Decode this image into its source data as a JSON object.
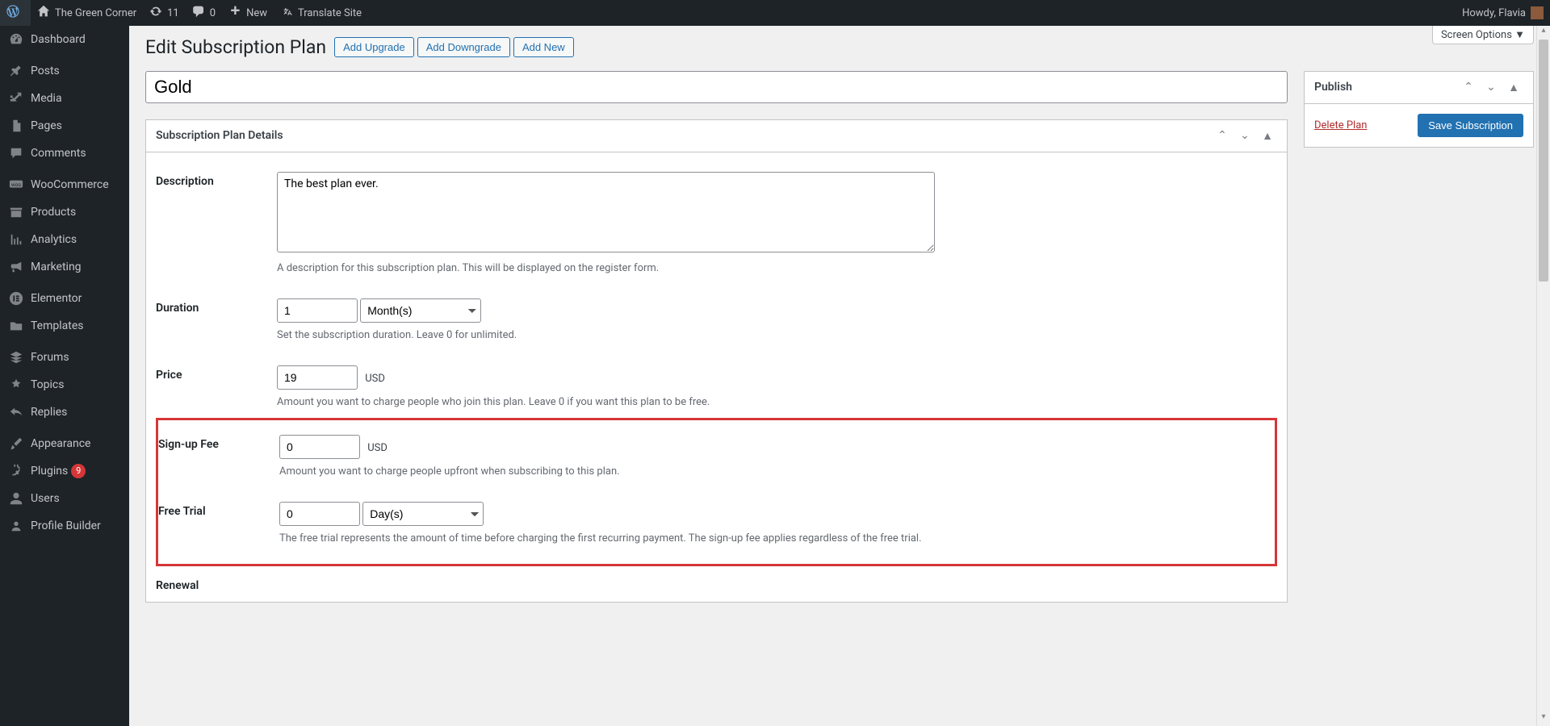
{
  "adminbar": {
    "site_name": "The Green Corner",
    "updates_count": "11",
    "comments_count": "0",
    "new_label": "New",
    "translate_label": "Translate Site",
    "howdy": "Howdy, Flavia"
  },
  "sidebar": {
    "items": [
      {
        "label": "Dashboard",
        "icon": "dashboard-icon"
      },
      {
        "sep": true
      },
      {
        "label": "Posts",
        "icon": "pin-icon"
      },
      {
        "label": "Media",
        "icon": "media-icon"
      },
      {
        "label": "Pages",
        "icon": "page-icon"
      },
      {
        "label": "Comments",
        "icon": "comment-icon"
      },
      {
        "sep": true
      },
      {
        "label": "WooCommerce",
        "icon": "woo-icon"
      },
      {
        "label": "Products",
        "icon": "archive-icon"
      },
      {
        "label": "Analytics",
        "icon": "chart-icon"
      },
      {
        "label": "Marketing",
        "icon": "megaphone-icon"
      },
      {
        "sep": true
      },
      {
        "label": "Elementor",
        "icon": "elementor-icon"
      },
      {
        "label": "Templates",
        "icon": "folder-icon"
      },
      {
        "sep": true
      },
      {
        "label": "Forums",
        "icon": "forum-icon"
      },
      {
        "label": "Topics",
        "icon": "topic-icon"
      },
      {
        "label": "Replies",
        "icon": "reply-icon"
      },
      {
        "sep": true
      },
      {
        "label": "Appearance",
        "icon": "brush-icon"
      },
      {
        "label": "Plugins",
        "icon": "plug-icon",
        "badge": "9"
      },
      {
        "label": "Users",
        "icon": "user-icon"
      },
      {
        "label": "Profile Builder",
        "icon": "profile-icon"
      }
    ]
  },
  "screen_options": "Screen Options ▼",
  "page": {
    "title": "Edit Subscription Plan",
    "buttons": {
      "add_upgrade": "Add Upgrade",
      "add_downgrade": "Add Downgrade",
      "add_new": "Add New"
    },
    "plan_title": "Gold"
  },
  "details": {
    "heading": "Subscription Plan Details",
    "description": {
      "label": "Description",
      "value": "The best plan ever.",
      "help": "A description for this subscription plan. This will be displayed on the register form."
    },
    "duration": {
      "label": "Duration",
      "value": "1",
      "unit": "Month(s)",
      "help": "Set the subscription duration. Leave 0 for unlimited."
    },
    "price": {
      "label": "Price",
      "value": "19",
      "currency": "USD",
      "help": "Amount you want to charge people who join this plan. Leave 0 if you want this plan to be free."
    },
    "signup_fee": {
      "label": "Sign-up Fee",
      "value": "0",
      "currency": "USD",
      "help": "Amount you want to charge people upfront when subscribing to this plan."
    },
    "free_trial": {
      "label": "Free Trial",
      "value": "0",
      "unit": "Day(s)",
      "help": "The free trial represents the amount of time before charging the first recurring payment. The sign-up fee applies regardless of the free trial."
    },
    "renewal": {
      "label": "Renewal"
    }
  },
  "publish": {
    "heading": "Publish",
    "delete": "Delete Plan",
    "save": "Save Subscription"
  }
}
